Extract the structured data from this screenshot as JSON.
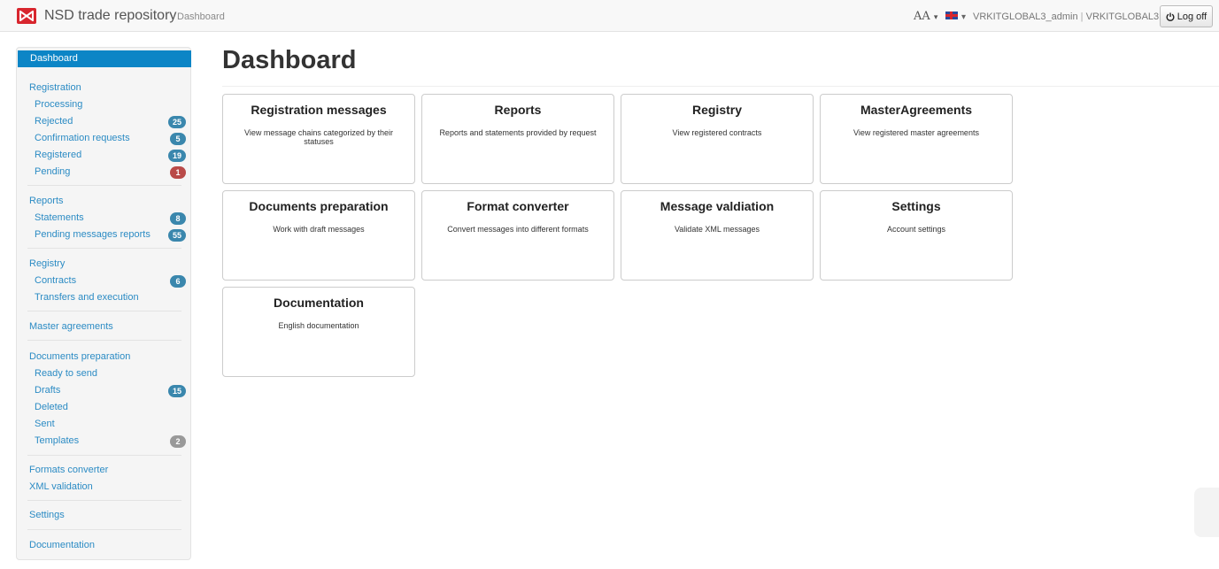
{
  "navbar": {
    "brand": "NSD trade repository",
    "crumb": "Dashboard",
    "font_toggle": "AA",
    "user": "VRKITGLOBAL3_admin",
    "org": "VRKITGLOBAL3",
    "logoff_label": "Log off",
    "brand_color": "#d8262e"
  },
  "sidebar": {
    "active_color": "#0c85c6",
    "dashboard": "Dashboard",
    "registration": {
      "title": "Registration",
      "items": [
        {
          "label": "Processing"
        },
        {
          "label": "Rejected",
          "badge": "25"
        },
        {
          "label": "Confirmation requests",
          "badge": "5"
        },
        {
          "label": "Registered",
          "badge": "19"
        },
        {
          "label": "Pending",
          "badge": "1"
        }
      ]
    },
    "reports": {
      "title": "Reports",
      "items": [
        {
          "label": "Statements",
          "badge": "8"
        },
        {
          "label": "Pending messages reports",
          "badge": "55"
        }
      ]
    },
    "registry": {
      "title": "Registry",
      "items": [
        {
          "label": "Contracts",
          "badge": "6"
        },
        {
          "label": "Transfers and execution"
        }
      ]
    },
    "master_agreements": "Master agreements",
    "documents": {
      "title": "Documents preparation",
      "items": [
        {
          "label": "Ready to send"
        },
        {
          "label": "Drafts",
          "badge": "15"
        },
        {
          "label": "Deleted"
        },
        {
          "label": "Sent"
        },
        {
          "label": "Templates",
          "badge": "2"
        }
      ]
    },
    "formats_converter": "Formats converter",
    "xml_validation": "XML validation",
    "settings": "Settings",
    "documentation": "Documentation"
  },
  "main": {
    "title": "Dashboard",
    "tiles": [
      {
        "title": "Registration messages",
        "desc": "View message chains categorized by their statuses"
      },
      {
        "title": "Reports",
        "desc": "Reports and statements provided by request"
      },
      {
        "title": "Registry",
        "desc": "View registered contracts"
      },
      {
        "title": "MasterAgreements",
        "desc": "View registered master agreements"
      },
      {
        "title": "Documents preparation",
        "desc": "Work with draft messages"
      },
      {
        "title": "Format converter",
        "desc": "Convert messages into different formats"
      },
      {
        "title": "Message valdiation",
        "desc": "Validate XML messages"
      },
      {
        "title": "Settings",
        "desc": "Account settings"
      },
      {
        "title": "Documentation",
        "desc": "English documentation"
      }
    ]
  }
}
